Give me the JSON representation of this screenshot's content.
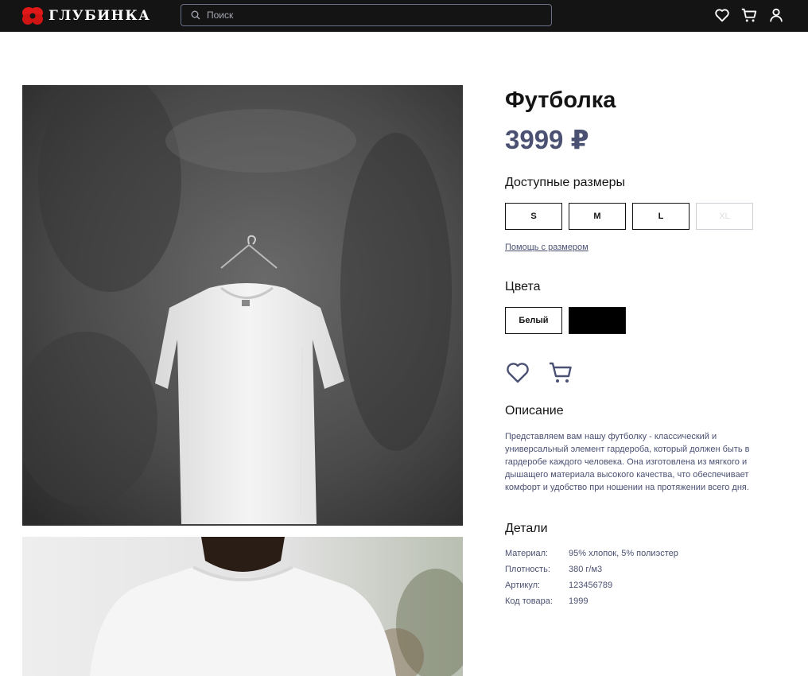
{
  "header": {
    "brand": "ГЛУБИНКА",
    "search_placeholder": "Поиск",
    "icons": [
      "heart-icon",
      "cart-icon",
      "user-icon"
    ],
    "background": "#141414"
  },
  "product": {
    "title": "Футболка",
    "price": "3999 ₽",
    "sizes_heading": "Доступные размеры",
    "sizes": [
      {
        "label": "S",
        "available": true
      },
      {
        "label": "M",
        "available": true
      },
      {
        "label": "L",
        "available": true
      },
      {
        "label": "XL",
        "available": false
      }
    ],
    "size_help": "Помощь с размером",
    "colors_heading": "Цвета",
    "colors": [
      {
        "label": "Белый",
        "value": "#ffffff"
      },
      {
        "label": "",
        "value": "#000000"
      }
    ],
    "description_heading": "Описание",
    "description": "Представляем вам нашу футболку - классический и универсальный элемент гардероба, который должен быть в гардеробе каждого человека. Она изготовлена из мягкого и дышащего материала высокого качества, что обеспечивает комфорт и удобство при ношении на протяжении всего дня.",
    "details_heading": "Детали",
    "details": [
      {
        "key": "Материал:",
        "value": "95% хлопок, 5% полиэстер"
      },
      {
        "key": "Плотность:",
        "value": "380 г/м3"
      },
      {
        "key": "Артикул:",
        "value": "123456789"
      },
      {
        "key": "Код товара:",
        "value": "1999"
      }
    ],
    "accent": "#4b5173"
  }
}
